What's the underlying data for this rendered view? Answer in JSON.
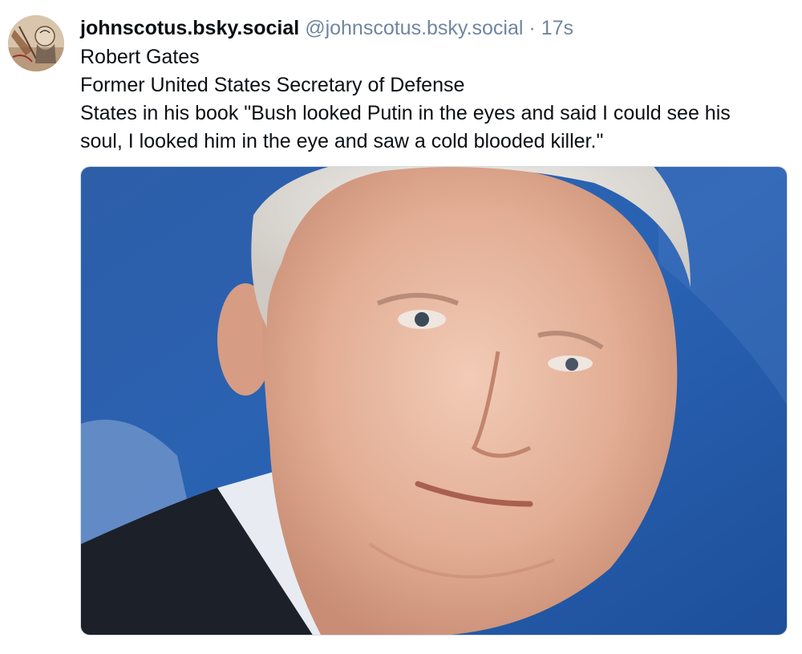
{
  "post": {
    "display_name": "johnscotus.bsky.social",
    "handle": "@johnscotus.bsky.social",
    "separator": "·",
    "timestamp": "17s",
    "text_lines": [
      "Robert Gates",
      "Former United States Secretary of Defense",
      "States in his book \"Bush looked Putin in the eyes and said I could see his",
      "soul, I looked him in the eye and saw a cold blooded killer.\""
    ]
  },
  "colors": {
    "name": "#0b0f14",
    "meta": "#6f869f",
    "background": "#ffffff"
  },
  "icons": {
    "avatar": "profile-picture",
    "media": "post-image"
  }
}
